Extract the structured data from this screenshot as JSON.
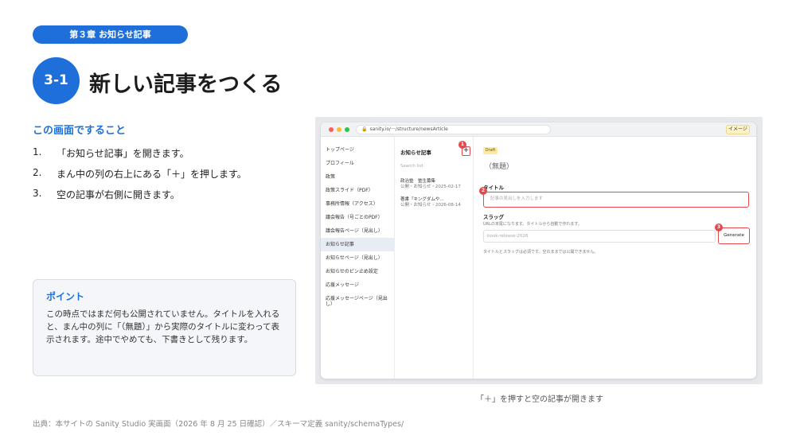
{
  "chapter": "第３章 お知らせ記事",
  "section_number": "3-1",
  "title": "新しい記事をつくる",
  "steps_heading": "この画面ですること",
  "steps": [
    {
      "num": "1.",
      "text": "「お知らせ記事」を開きます。"
    },
    {
      "num": "2.",
      "text": "まん中の列の右上にある「＋」を押します。"
    },
    {
      "num": "3.",
      "text": "空の記事が右側に開きます。"
    }
  ],
  "point": {
    "title": "ポイント",
    "text": "この時点ではまだ何も公開されていません。タイトルを入れると、まん中の列に「（無題）」から実際のタイトルに変わって表示されます。途中でやめても、下書きとして残ります。"
  },
  "source": "出典：本サイトの Sanity Studio 実画面（2026 年 8 月 25 日確認）／スキーマ定義 sanity/schemaTypes/",
  "caption": "「＋」を押すと空の記事が開きます",
  "screenshot": {
    "url": "sanity.io/···/structure/newsArticle",
    "image_button": "イメージ",
    "nav_items": [
      {
        "label": "トップページ"
      },
      {
        "label": "プロフィール"
      },
      {
        "label": "政策"
      },
      {
        "label": "政策スライド（PDF）"
      },
      {
        "label": "事務所情報（アクセス）"
      },
      {
        "label": "議会報告（号ごとのPDF）"
      },
      {
        "label": "議会報告ページ（見出し）"
      },
      {
        "label": "お知らせ記事",
        "active": true
      },
      {
        "label": "お知らせページ（見出し）"
      },
      {
        "label": "お知らせのピン止め設定"
      },
      {
        "label": "応援メッセージ"
      },
      {
        "label": "応援メッセージページ（見出し）"
      }
    ],
    "list_title": "お知らせ記事",
    "plus": "+",
    "search_placeholder": "Search list",
    "docs": [
      {
        "title": "政治塾　塾生募集",
        "meta": "公開・お知らせ・2025-02-17"
      },
      {
        "title": "著書『キングダムや…",
        "meta": "公開・お知らせ・2026-08-14"
      }
    ],
    "draft": "Draft",
    "untitled": "（無題）",
    "title_label": "タイトル",
    "title_placeholder": "記事の見出しを入力します",
    "slug_label": "スラッグ",
    "slug_help": "URLの末尾になります。タイトルから自動で作れます。",
    "slug_placeholder": "book-release-2026",
    "generate": "Generate",
    "note": "タイトルとスラッグは必須です。空のままでは公開できません。",
    "badges": [
      "1",
      "2",
      "3"
    ]
  },
  "colors": {
    "accent": "#1e6fd9",
    "highlight": "#e5484d"
  }
}
